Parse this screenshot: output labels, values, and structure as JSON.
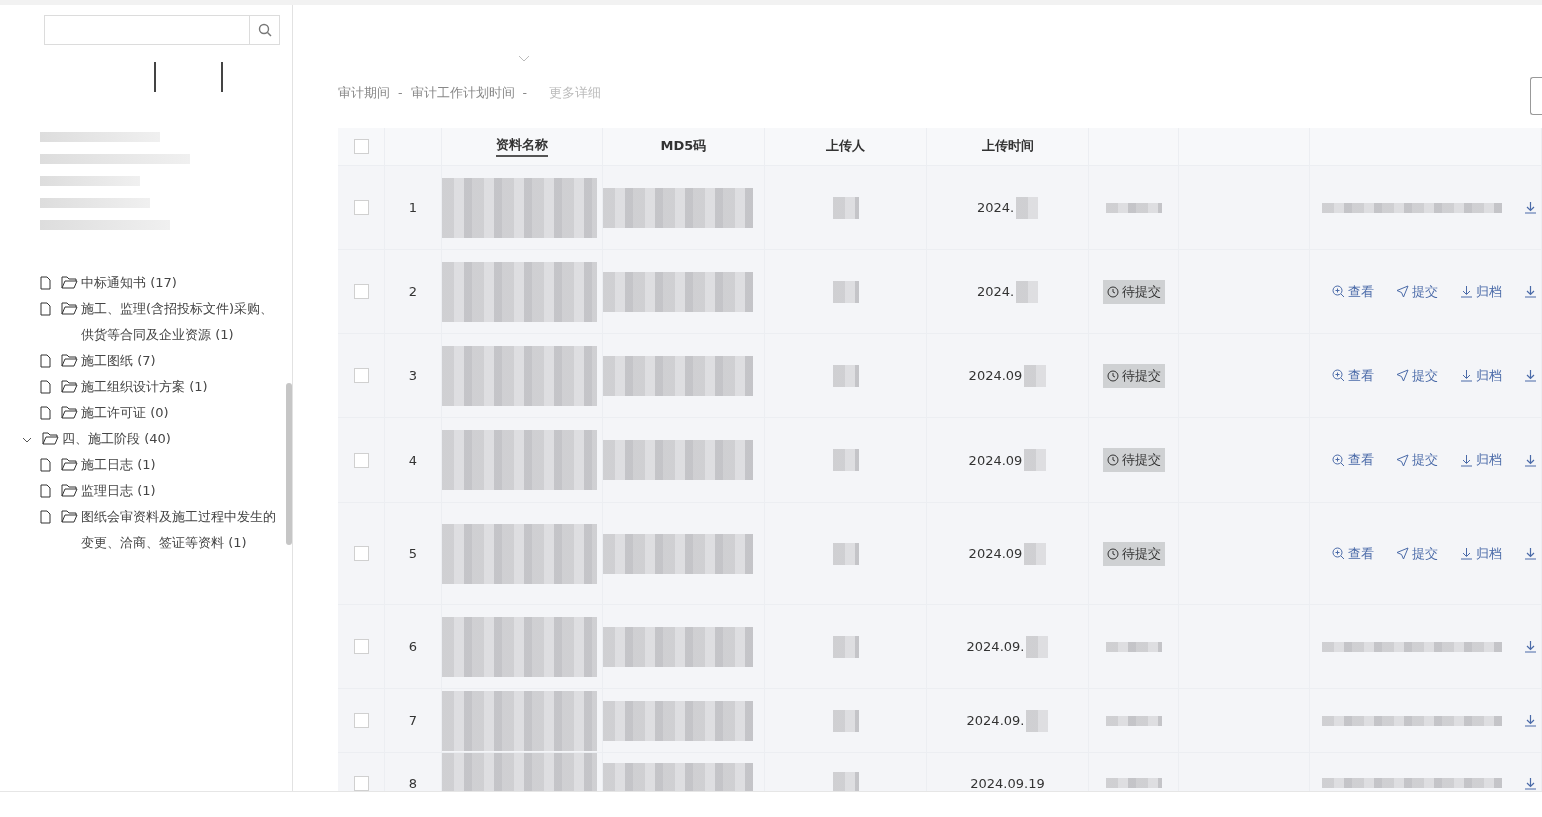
{
  "sidebar": {
    "tree": [
      {
        "children": [
          {
            "label": "中标通知书 (17)"
          },
          {
            "label": "施工、监理(含招投标文件)采购、供货等合同及企业资源 (1)"
          },
          {
            "label": "施工图纸 (7)"
          },
          {
            "label": "施工组织设计方案 (1)"
          },
          {
            "label": "施工许可证 (0)"
          }
        ]
      },
      {
        "label": "四、施工阶段 (40)",
        "expanded": true,
        "children": [
          {
            "label": "施工日志 (1)"
          },
          {
            "label": "监理日志 (1)"
          },
          {
            "label": "图纸会审资料及施工过程中发生的变更、洽商、签证等资料 (1)"
          }
        ]
      }
    ]
  },
  "info": {
    "audit_period": "审计期间",
    "separator_1": "-",
    "plan_time": "审计工作计划时间",
    "separator_2": "-",
    "more": "更多详细"
  },
  "table": {
    "all_selected": false,
    "columns": [
      {
        "label": "资料名称",
        "sorted": true
      },
      {
        "label": "MD5码",
        "sorted": false
      },
      {
        "label": "上传人",
        "sorted": false
      },
      {
        "label": "上传时间",
        "sorted": false
      }
    ],
    "rows": [
      {
        "index": "1",
        "date": "2024.",
        "selected": false
      },
      {
        "index": "2",
        "date": "2024.",
        "selected": false,
        "status": "待提交",
        "actions": [
          "查看",
          "提交",
          "归档"
        ]
      },
      {
        "index": "3",
        "date": "2024.09",
        "selected": false,
        "status": "待提交",
        "actions": [
          "查看",
          "提交",
          "归档"
        ]
      },
      {
        "index": "4",
        "date": "2024.09",
        "selected": false,
        "status": "待提交",
        "actions": [
          "查看",
          "提交",
          "归档"
        ]
      },
      {
        "index": "5",
        "date": "2024.09",
        "selected": false,
        "status": "待提交",
        "actions": [
          "查看",
          "提交",
          "归档"
        ]
      },
      {
        "index": "6",
        "date": "2024.09.",
        "selected": false
      },
      {
        "index": "7",
        "date": "2024.09.",
        "selected": false
      },
      {
        "index": "8",
        "date": "2024.09.19",
        "selected": false
      }
    ]
  }
}
